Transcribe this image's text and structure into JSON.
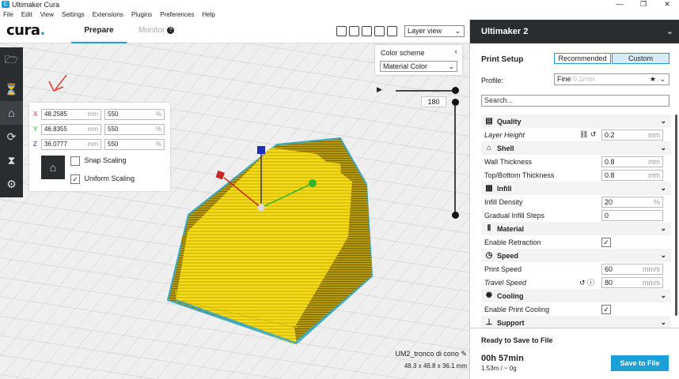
{
  "window": {
    "title": "Ultimaker Cura",
    "min": "—",
    "max": "❐",
    "close": "✕"
  },
  "menu": [
    "File",
    "Edit",
    "View",
    "Settings",
    "Extensions",
    "Plugins",
    "Preferences",
    "Help"
  ],
  "topbar": {
    "logo": "cura",
    "logo_dot": ".",
    "tab_prepare": "Prepare",
    "tab_monitor": "Monitor",
    "view_select": "Layer view"
  },
  "scale": {
    "x_label": "X",
    "x_mm": "48.2585",
    "x_pct": "550",
    "y_label": "Y",
    "y_mm": "46.8355",
    "y_pct": "550",
    "z_label": "Z",
    "z_mm": "36.0777",
    "z_pct": "550",
    "unit_mm": "mm",
    "unit_pct": "%",
    "snap_label": "Snap Scaling",
    "snap_checked": false,
    "uniform_label": "Uniform Scaling",
    "uniform_checked": true
  },
  "colorscheme": {
    "title": "Color scheme",
    "value": "Material Color"
  },
  "layer": {
    "current": "180"
  },
  "model": {
    "name": "UM2_tronco di cono",
    "dims": "48.3 x 46.8 x 36.1 mm"
  },
  "sidebar": {
    "printer": "Ultimaker 2",
    "setup_label": "Print Setup",
    "recommended": "Recommended",
    "custom": "Custom",
    "profile_label": "Profile:",
    "profile_value": "Fine",
    "profile_sub": "0.1mm",
    "search_placeholder": "Search..."
  },
  "settings": [
    {
      "type": "cat",
      "icon": "▤",
      "label": "Quality"
    },
    {
      "type": "setting",
      "label": "Layer Height",
      "italic": true,
      "value": "0.2",
      "unit": "mm"
    },
    {
      "type": "cat",
      "icon": "⌂",
      "label": "Shell"
    },
    {
      "type": "setting",
      "label": "Wall Thickness",
      "value": "0.8",
      "unit": "mm"
    },
    {
      "type": "setting",
      "label": "Top/Bottom Thickness",
      "value": "0.8",
      "unit": "mm"
    },
    {
      "type": "cat",
      "icon": "▦",
      "label": "Infill"
    },
    {
      "type": "setting",
      "label": "Infill Density",
      "value": "20",
      "unit": "%"
    },
    {
      "type": "setting",
      "label": "Gradual Infill Steps",
      "value": "0",
      "unit": ""
    },
    {
      "type": "cat",
      "icon": "⦀",
      "label": "Material"
    },
    {
      "type": "check",
      "label": "Enable Retraction",
      "checked": true
    },
    {
      "type": "cat",
      "icon": "◷",
      "label": "Speed"
    },
    {
      "type": "setting",
      "label": "Print Speed",
      "value": "60",
      "unit": "mm/s"
    },
    {
      "type": "setting",
      "label": "Travel Speed",
      "italic": true,
      "value": "80",
      "unit": "mm/s"
    },
    {
      "type": "cat",
      "icon": "✺",
      "label": "Cooling"
    },
    {
      "type": "check",
      "label": "Enable Print Cooling",
      "checked": true
    },
    {
      "type": "cat",
      "icon": "⊥",
      "label": "Support"
    }
  ],
  "footer": {
    "status": "Ready to Save to File",
    "time": "00h 57min",
    "material": "1.53m / ~ 0g",
    "save": "Save to File"
  },
  "colors": {
    "accent": "#1b9fd7",
    "dark": "#2a2d30",
    "print_yellow": "#f5e21a",
    "print_edge": "#3aa9c9"
  }
}
